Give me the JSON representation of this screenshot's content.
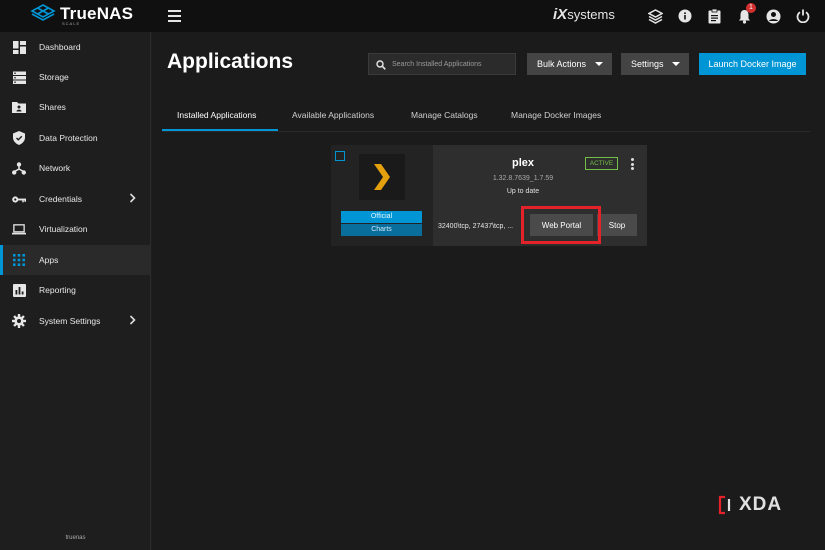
{
  "header": {
    "brand": "TrueNAS",
    "brand_sub": "SCALE",
    "vendor_ix": "iX",
    "vendor_systems": "systems",
    "notification_count": "1",
    "icons": [
      "menu-icon",
      "truecommand-icon",
      "info-icon",
      "clipboard-icon",
      "bell-icon",
      "account-icon",
      "power-icon"
    ]
  },
  "sidebar": {
    "items": [
      {
        "label": "Dashboard",
        "icon": "dashboard-icon"
      },
      {
        "label": "Storage",
        "icon": "storage-icon"
      },
      {
        "label": "Shares",
        "icon": "shares-icon"
      },
      {
        "label": "Data Protection",
        "icon": "shield-icon"
      },
      {
        "label": "Network",
        "icon": "network-icon"
      },
      {
        "label": "Credentials",
        "icon": "key-icon"
      },
      {
        "label": "Virtualization",
        "icon": "laptop-icon"
      },
      {
        "label": "Apps",
        "icon": "apps-grid-icon"
      },
      {
        "label": "Reporting",
        "icon": "chart-icon"
      },
      {
        "label": "System Settings",
        "icon": "gear-icon"
      }
    ],
    "hostname": "truenas"
  },
  "page": {
    "title": "Applications",
    "search_placeholder": "Search Installed Applications",
    "bulk_actions": "Bulk Actions",
    "settings": "Settings",
    "launch_docker": "Launch Docker Image"
  },
  "tabs": [
    {
      "label": "Installed Applications",
      "active": true
    },
    {
      "label": "Available Applications",
      "active": false
    },
    {
      "label": "Manage Catalogs",
      "active": false
    },
    {
      "label": "Manage Docker Images",
      "active": false
    }
  ],
  "app_card": {
    "name": "plex",
    "version": "1.32.8.7639_1.7.59",
    "status": "Up to date",
    "state": "ACTIVE",
    "train_line1": "Official",
    "train_line2": "Charts",
    "ports": "32400\\tcp, 27437\\tcp, ...",
    "web_portal": "Web Portal",
    "stop": "Stop"
  },
  "watermark": "XDA",
  "colors": {
    "accent": "#0095d5",
    "active_green": "#71bf44",
    "highlight_red": "#e3222a",
    "plex_orange": "#e5a00d"
  }
}
